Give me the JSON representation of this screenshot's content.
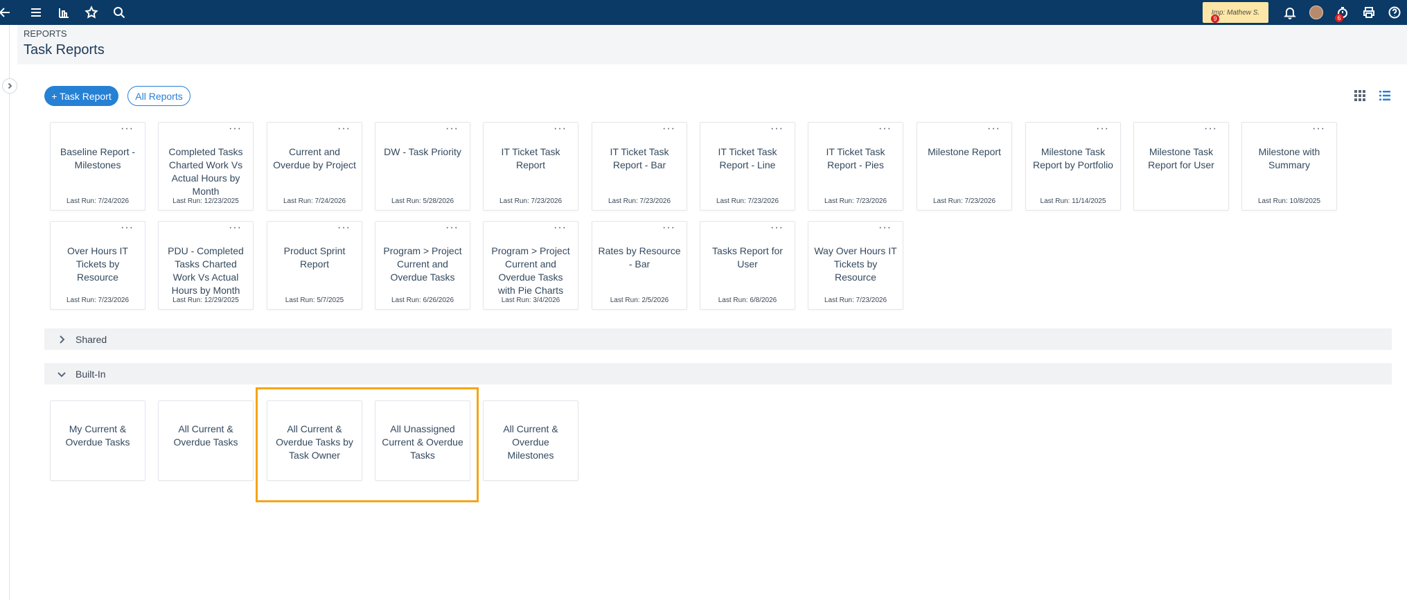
{
  "topbar": {
    "impersonation_text": "Imp: Mathew S.",
    "impersonation_badge": "9",
    "timer_badge": "6"
  },
  "header": {
    "breadcrumb": "REPORTS",
    "title": "Task Reports"
  },
  "actions": {
    "add_report": "+ Task Report",
    "all_reports": "All Reports"
  },
  "my_reports": [
    {
      "title": "Baseline Report - Milestones",
      "last_run": "Last Run: 7/24/2026"
    },
    {
      "title": "Completed Tasks Charted Work Vs Actual Hours by Month",
      "last_run": "Last Run: 12/23/2025"
    },
    {
      "title": "Current and Overdue by Project",
      "last_run": "Last Run: 7/24/2026"
    },
    {
      "title": "DW - Task Priority",
      "last_run": "Last Run: 5/28/2026"
    },
    {
      "title": "IT Ticket Task Report",
      "last_run": "Last Run: 7/23/2026"
    },
    {
      "title": "IT Ticket Task Report - Bar",
      "last_run": "Last Run: 7/23/2026"
    },
    {
      "title": "IT Ticket Task Report - Line",
      "last_run": "Last Run: 7/23/2026"
    },
    {
      "title": "IT Ticket Task Report - Pies",
      "last_run": "Last Run: 7/23/2026"
    },
    {
      "title": "Milestone Report",
      "last_run": "Last Run: 7/23/2026"
    },
    {
      "title": "Milestone Task Report by Portfolio",
      "last_run": "Last Run: 11/14/2025"
    },
    {
      "title": "Milestone Task Report for User",
      "last_run": ""
    },
    {
      "title": "Milestone with Summary",
      "last_run": "Last Run: 10/8/2025"
    },
    {
      "title": "Over Hours IT Tickets by Resource",
      "last_run": "Last Run: 7/23/2026"
    },
    {
      "title": "PDU - Completed Tasks Charted Work Vs Actual Hours by Month",
      "last_run": "Last Run: 12/29/2025"
    },
    {
      "title": "Product Sprint Report",
      "last_run": "Last Run: 5/7/2025"
    },
    {
      "title": "Program > Project Current and Overdue Tasks",
      "last_run": "Last Run: 6/26/2026"
    },
    {
      "title": "Program > Project Current and Overdue Tasks with Pie Charts",
      "last_run": "Last Run: 3/4/2026"
    },
    {
      "title": "Rates by Resource - Bar",
      "last_run": "Last Run: 2/5/2026"
    },
    {
      "title": "Tasks Report for User",
      "last_run": "Last Run: 6/8/2026"
    },
    {
      "title": "Way Over Hours IT Tickets by Resource",
      "last_run": "Last Run: 7/23/2026"
    }
  ],
  "sections": {
    "shared": "Shared",
    "builtin": "Built-In"
  },
  "builtin_reports": [
    {
      "title": "My Current & Overdue Tasks"
    },
    {
      "title": "All Current & Overdue Tasks"
    },
    {
      "title": "All Current & Overdue Tasks by Task Owner"
    },
    {
      "title": "All Unassigned Current & Overdue Tasks"
    },
    {
      "title": "All Current & Overdue Milestones"
    }
  ],
  "colors": {
    "topbar": "#0b3a66",
    "accent": "#2680d4",
    "highlight": "#f5a418"
  }
}
